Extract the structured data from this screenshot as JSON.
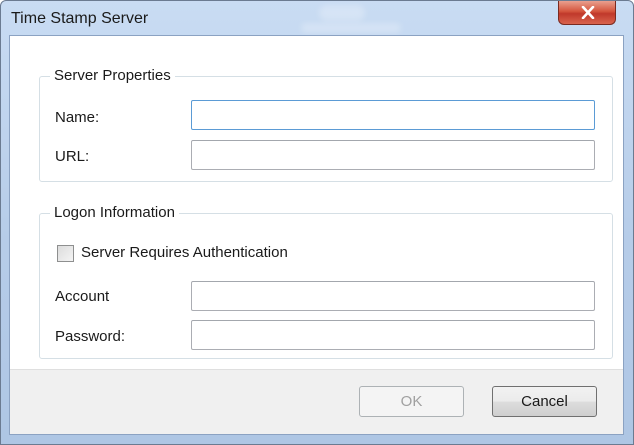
{
  "window": {
    "title": "Time Stamp Server"
  },
  "server_properties": {
    "legend": "Server Properties",
    "name_label": "Name:",
    "name_value": "",
    "url_label": "URL:",
    "url_value": ""
  },
  "logon_information": {
    "legend": "Logon Information",
    "auth_checkbox_label": "Server Requires Authentication",
    "auth_checked": false,
    "account_label": "Account",
    "account_value": "",
    "password_label": "Password:",
    "password_value": ""
  },
  "buttons": {
    "ok_label": "OK",
    "cancel_label": "Cancel"
  },
  "icons": {
    "close": "close-icon"
  }
}
